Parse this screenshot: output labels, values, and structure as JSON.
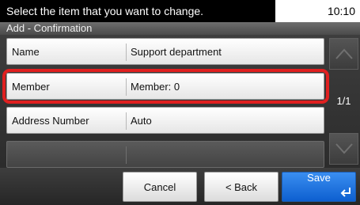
{
  "status_bar": {
    "message": "Select the item that you want to change.",
    "time": "10:10"
  },
  "title": "Add - Confirmation",
  "rows": [
    {
      "label": "Name",
      "value": "Support department"
    },
    {
      "label": "Member",
      "value": "Member:  0"
    },
    {
      "label": "Address Number",
      "value": "Auto"
    }
  ],
  "pagination": {
    "indicator": "1/1"
  },
  "buttons": {
    "cancel": "Cancel",
    "back": "< Back",
    "save": "Save"
  },
  "colors": {
    "highlight": "#e02020",
    "save_button": "#1f74e0"
  },
  "icons": {
    "scroll_up": "chevron-up-icon",
    "scroll_down": "chevron-down-icon",
    "enter": "enter-key-icon"
  }
}
